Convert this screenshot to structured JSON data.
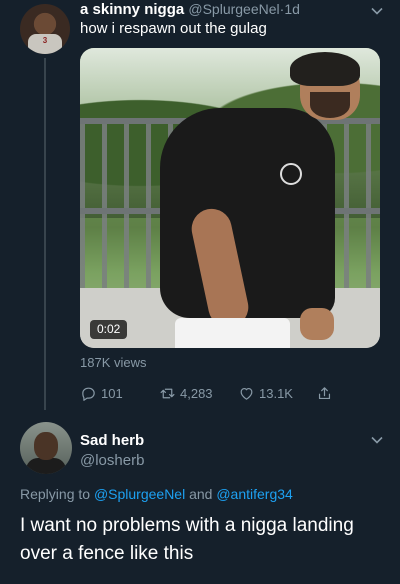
{
  "tweet": {
    "display_name": "a skinny nigga",
    "handle": "@SplurgeeNel",
    "separator": "·",
    "time": "1d",
    "text": "how i respawn out the gulag",
    "avatar_jersey_text": "3",
    "video": {
      "duration": "0:02"
    },
    "views": "187K views",
    "actions": {
      "reply_count": "101",
      "retweet_count": "4,283",
      "like_count": "13.1K"
    }
  },
  "reply": {
    "display_name": "Sad herb",
    "handle": "@losherb",
    "replying_prefix": "Replying to",
    "replying_user1": "@SplurgeeNel",
    "replying_and": "and",
    "replying_user2": "@antiferg34",
    "text": "I want no problems with a nigga landing over a fence like this"
  },
  "colors": {
    "background": "#15202b",
    "secondary_text": "#8899a6",
    "link": "#1da1f2",
    "thread_line": "#38444d"
  },
  "icons": [
    "chevron-down-icon",
    "reply-icon",
    "retweet-icon",
    "like-icon",
    "share-icon"
  ]
}
